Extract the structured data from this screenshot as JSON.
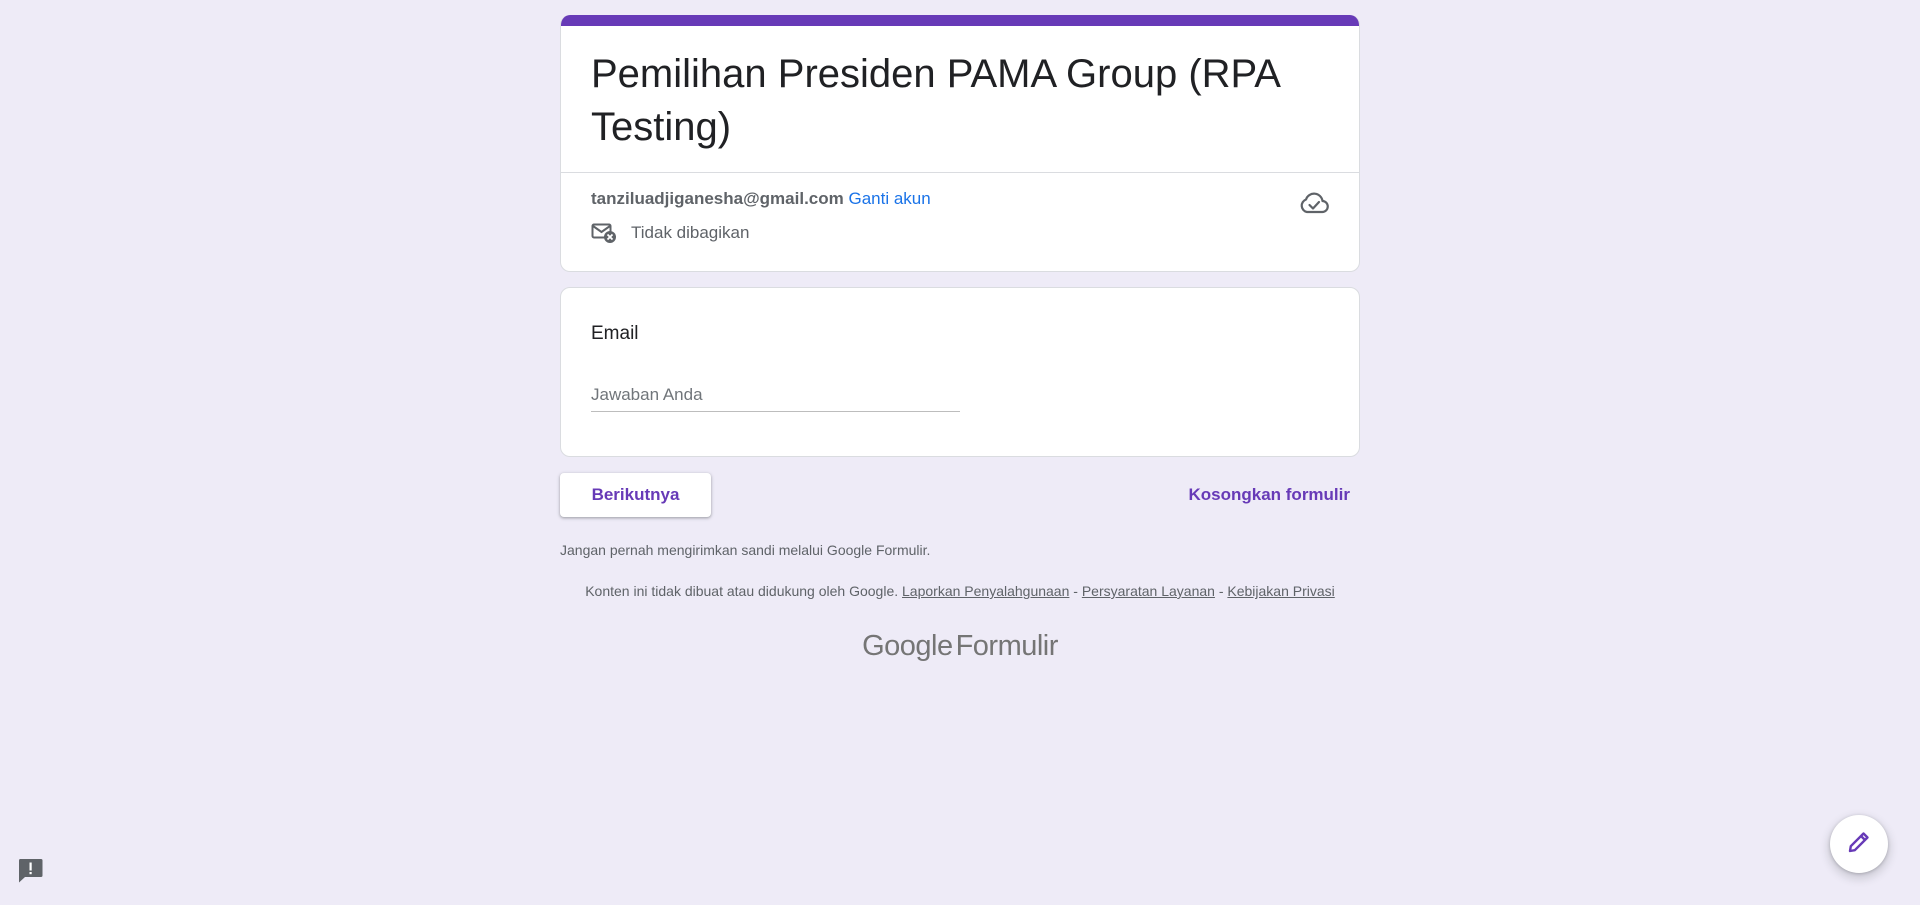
{
  "form": {
    "title": "Pemilihan Presiden PAMA Group (RPA Testing)",
    "account_email": "tanziluadjiganesha@gmail.com",
    "switch_account_label": "Ganti akun",
    "share_status": "Tidak dibagikan",
    "accent_color": "#673ab7",
    "background_color": "#eeebf7"
  },
  "question": {
    "title": "Email",
    "placeholder": "Jawaban Anda"
  },
  "actions": {
    "next_label": "Berikutnya",
    "clear_label": "Kosongkan formulir"
  },
  "footer": {
    "warning": "Jangan pernah mengirimkan sandi melalui Google Formulir.",
    "disclaimer": "Konten ini tidak dibuat atau didukung oleh Google.",
    "report_abuse": "Laporkan Penyalahgunaan",
    "separator": "-",
    "terms": "Persyaratan Layanan",
    "privacy": "Kebijakan Privasi",
    "brand_google": "Google",
    "brand_product": "Formulir"
  },
  "icons": {
    "mail_off": "mail-not-shared-icon",
    "cloud": "cloud-saved-icon",
    "feedback": "feedback-icon",
    "edit": "edit-pencil-icon"
  }
}
